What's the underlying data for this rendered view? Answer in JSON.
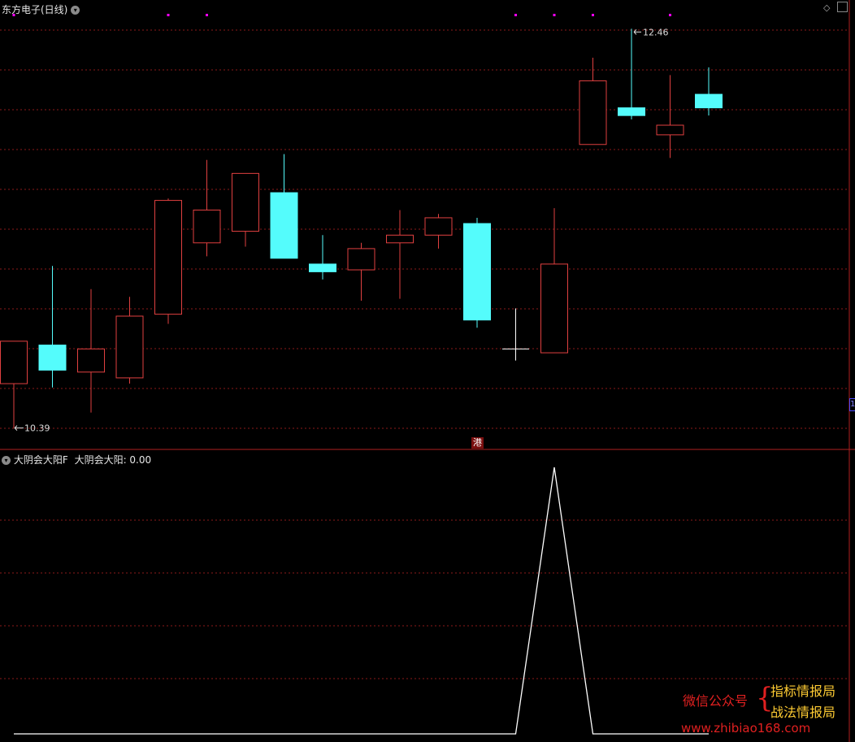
{
  "header": {
    "title": "东方电子(日线)",
    "indicator_name": "大阴会大阳F",
    "indicator_value_label": "大阴会大阳: 0.00"
  },
  "markers": {
    "high_label": "12.46",
    "low_label": "10.39",
    "market_tag": "港",
    "right_edge_tag": "1"
  },
  "watermark": {
    "wechat": "微信公众号",
    "line1": "指标情报局",
    "line2": "战法情报局",
    "url": "www.zhibiao168.com"
  },
  "colors": {
    "up": "#e04040",
    "down": "#54fcfc",
    "doji": "#ffffff",
    "grid": "#8b1a1a",
    "frame": "#b02020",
    "signal_dot": "#ff00ff",
    "indicator_line": "#ffffff"
  },
  "chart_data": [
    {
      "type": "candlestick",
      "title": "东方电子(日线)",
      "ylim": [
        10.3,
        12.55
      ],
      "series": [
        {
          "o": 10.62,
          "h": 10.62,
          "l": 10.39,
          "c": 10.84
        },
        {
          "o": 10.82,
          "h": 11.23,
          "l": 10.6,
          "c": 10.69
        },
        {
          "o": 10.68,
          "h": 11.11,
          "l": 10.47,
          "c": 10.8
        },
        {
          "o": 10.65,
          "h": 11.07,
          "l": 10.62,
          "c": 10.97
        },
        {
          "o": 10.98,
          "h": 11.58,
          "l": 10.93,
          "c": 11.57
        },
        {
          "o": 11.35,
          "h": 11.78,
          "l": 11.28,
          "c": 11.52
        },
        {
          "o": 11.41,
          "h": 11.7,
          "l": 11.33,
          "c": 11.71
        },
        {
          "o": 11.61,
          "h": 11.81,
          "l": 11.29,
          "c": 11.27
        },
        {
          "o": 11.24,
          "h": 11.39,
          "l": 11.16,
          "c": 11.2
        },
        {
          "o": 11.21,
          "h": 11.35,
          "l": 11.05,
          "c": 11.32
        },
        {
          "o": 11.35,
          "h": 11.52,
          "l": 11.06,
          "c": 11.39
        },
        {
          "o": 11.39,
          "h": 11.5,
          "l": 11.32,
          "c": 11.48
        },
        {
          "o": 11.45,
          "h": 11.48,
          "l": 10.91,
          "c": 10.95
        },
        {
          "o": 10.8,
          "h": 11.01,
          "l": 10.74,
          "c": 10.8
        },
        {
          "o": 10.78,
          "h": 11.53,
          "l": 10.78,
          "c": 11.24
        },
        {
          "o": 11.86,
          "h": 12.31,
          "l": 11.86,
          "c": 12.19
        },
        {
          "o": 12.05,
          "h": 12.46,
          "l": 11.99,
          "c": 12.01
        },
        {
          "o": 11.91,
          "h": 12.22,
          "l": 11.79,
          "c": 11.96
        },
        {
          "o": 12.12,
          "h": 12.26,
          "l": 12.01,
          "c": 12.05
        }
      ],
      "signal_markers_at_index": [
        0,
        4,
        5,
        13,
        14,
        15,
        17
      ]
    },
    {
      "type": "line",
      "title": "大阴会大阳F",
      "series": [
        {
          "name": "大阴会大阳",
          "values": [
            0,
            0,
            0,
            0,
            0,
            0,
            0,
            0,
            0,
            0,
            0,
            0,
            0,
            0,
            1,
            0,
            0,
            0,
            0
          ]
        }
      ],
      "ylim": [
        0,
        1.0
      ]
    }
  ]
}
